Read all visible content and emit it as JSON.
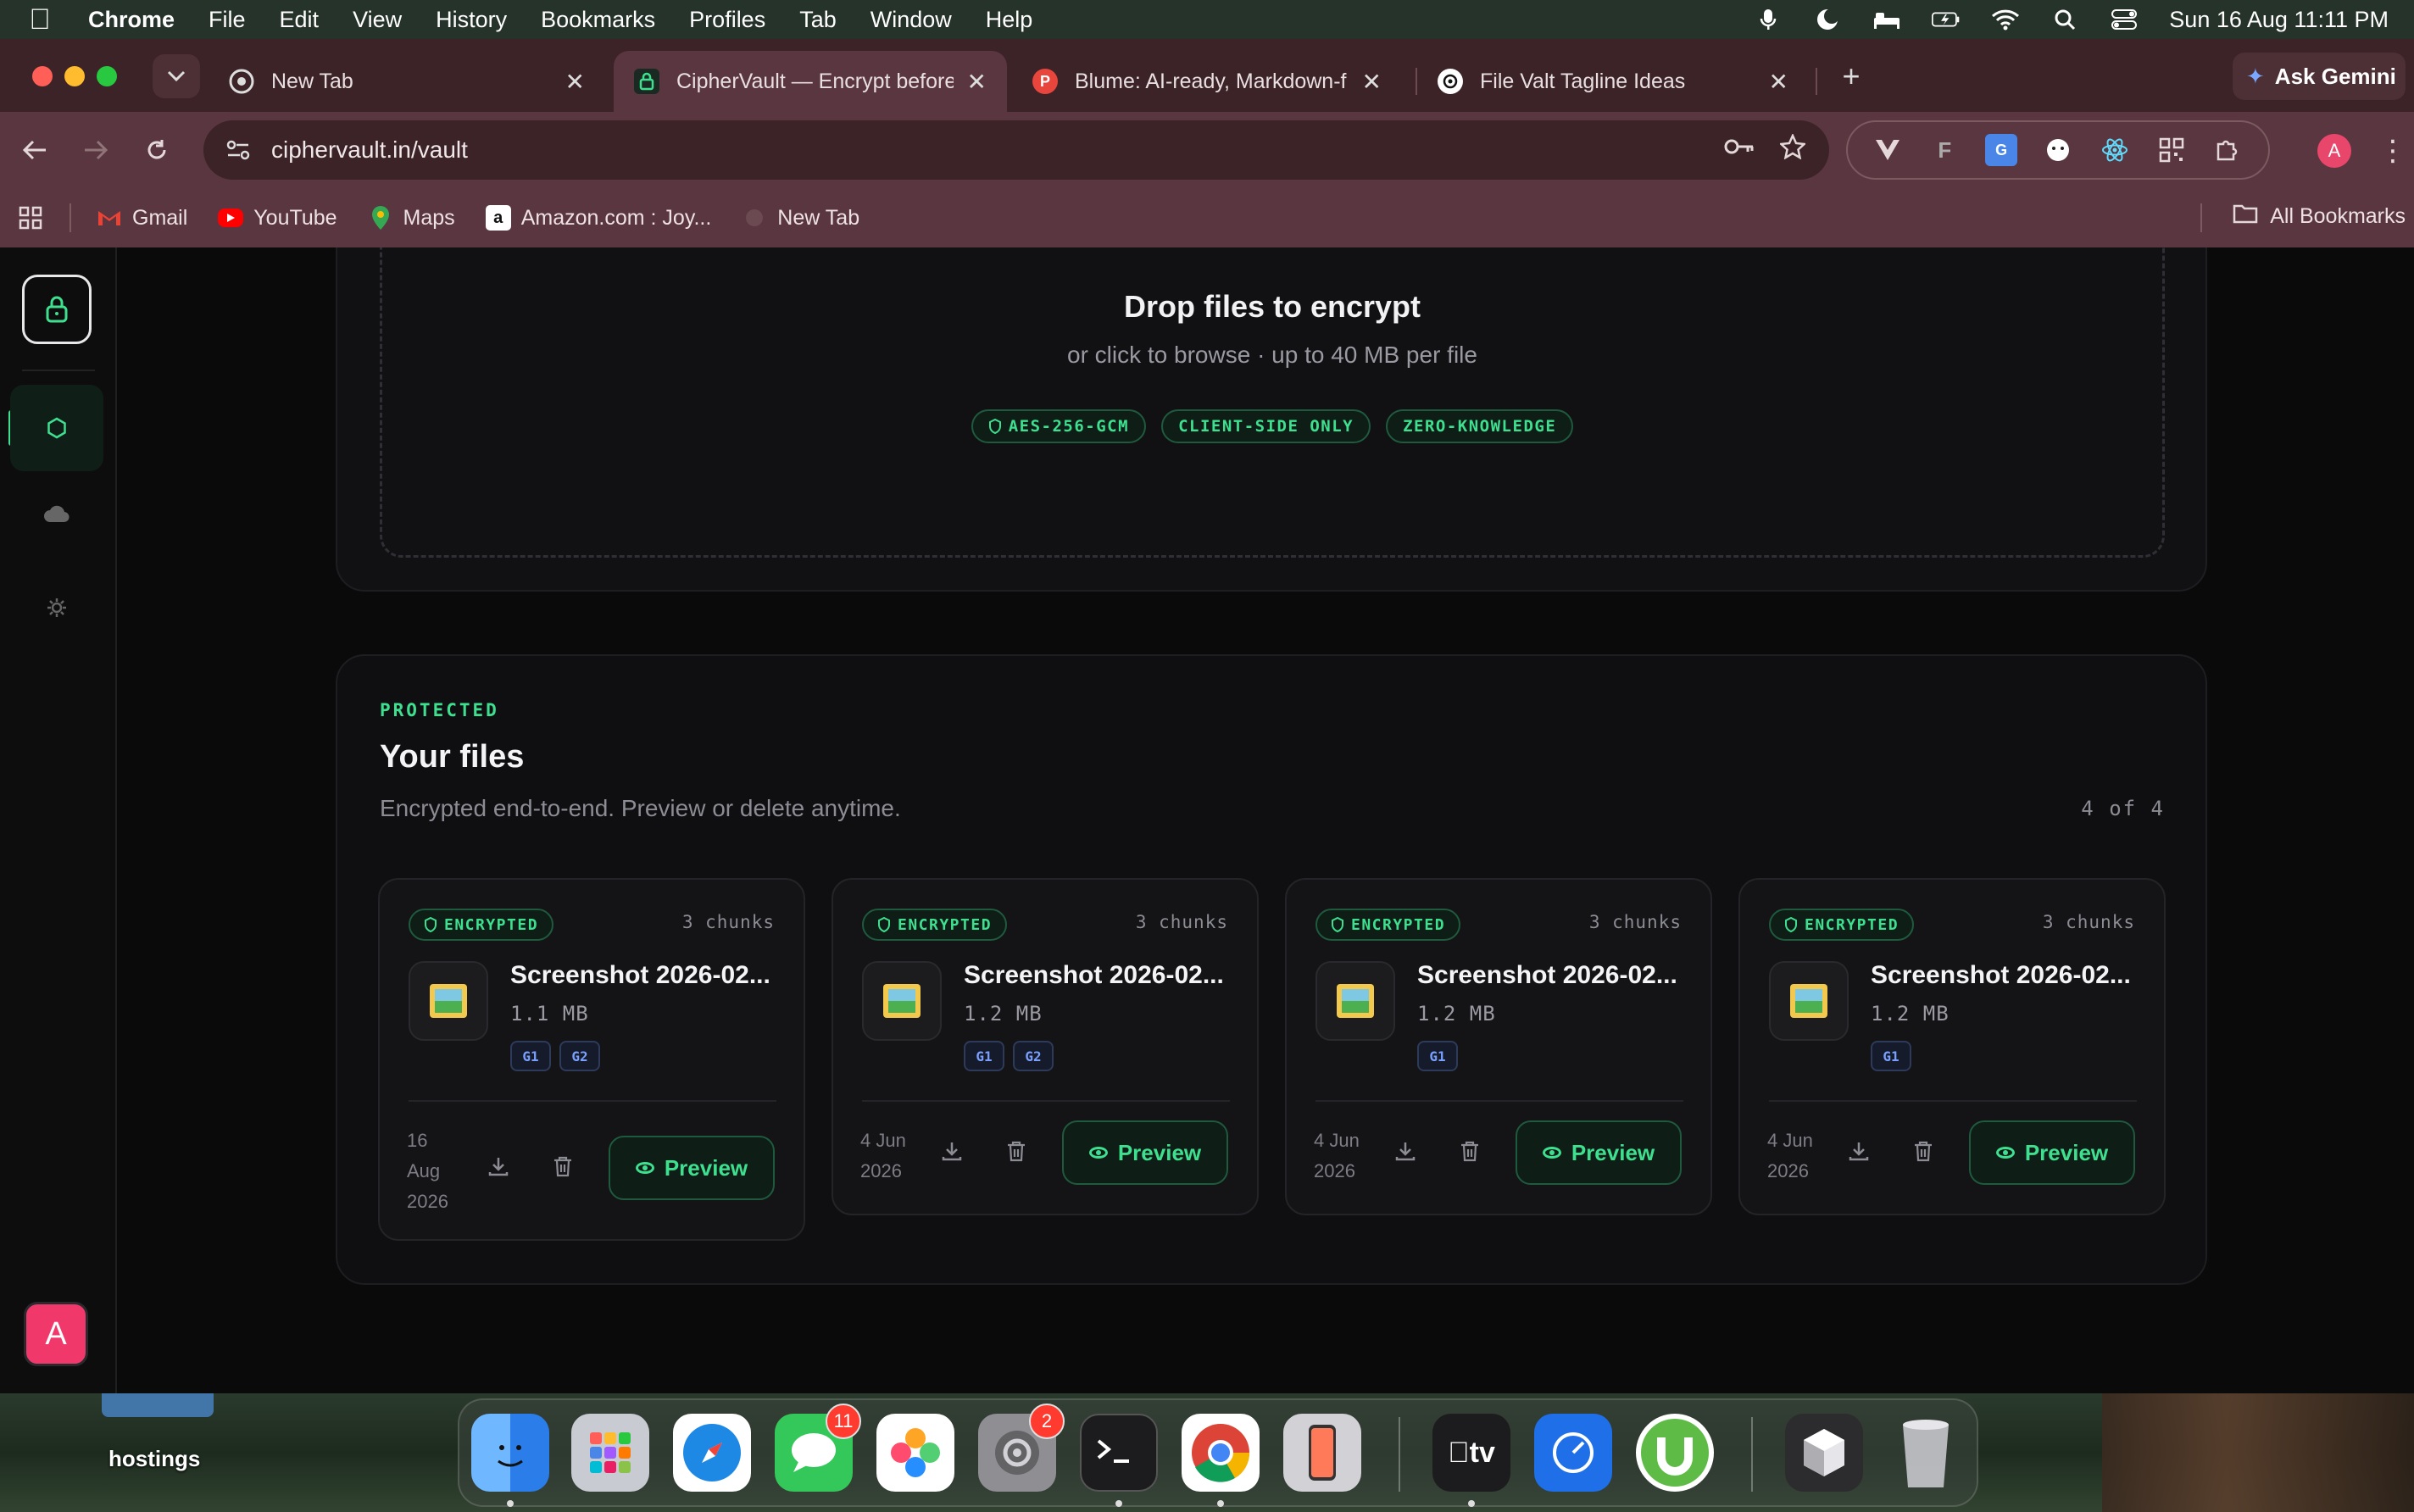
{
  "menubar": {
    "app_name": "Chrome",
    "items": [
      "File",
      "Edit",
      "View",
      "History",
      "Bookmarks",
      "Profiles",
      "Tab",
      "Window",
      "Help"
    ],
    "clock": "Sun 16 Aug  11:11 PM"
  },
  "tabs": [
    {
      "title": "New Tab",
      "icon": "chrome-icon",
      "active": false
    },
    {
      "title": "CipherVault — Encrypt before",
      "icon": "lock-icon",
      "active": true
    },
    {
      "title": "Blume: AI-ready, Markdown-f",
      "icon": "p-icon",
      "active": false
    },
    {
      "title": "File Valt Tagline Ideas",
      "icon": "openai-icon",
      "active": false
    }
  ],
  "gemini_label": "Ask Gemini",
  "address_bar": {
    "url": "ciphervault.in/vault"
  },
  "profile_initial": "A",
  "bookmarks": [
    {
      "label": "Gmail",
      "icon": "gmail-icon"
    },
    {
      "label": "YouTube",
      "icon": "youtube-icon"
    },
    {
      "label": "Maps",
      "icon": "maps-icon"
    },
    {
      "label": "Amazon.com : Joy...",
      "icon": "amazon-icon"
    },
    {
      "label": "New Tab",
      "icon": "globe-icon"
    }
  ],
  "all_bookmarks_label": "All Bookmarks",
  "app": {
    "avatar_initial": "A",
    "drop_zone": {
      "title": "Drop files to encrypt",
      "subtitle": "or click to browse · up to 40 MB per file",
      "badges": [
        "AES-256-GCM",
        "CLIENT-SIDE ONLY",
        "ZERO-KNOWLEDGE"
      ]
    },
    "files_section": {
      "eyebrow": "PROTECTED",
      "title": "Your files",
      "subtitle": "Encrypted end-to-end. Preview or delete anytime.",
      "count": "4 of 4",
      "badge_label": "ENCRYPTED",
      "preview_label": "Preview",
      "files": [
        {
          "name": "Screenshot 2026-02...",
          "size": "1.1 MB",
          "chunks": "3 chunks",
          "tags": [
            "G1",
            "G2"
          ],
          "date_lines": [
            "16",
            "Aug",
            "2026"
          ]
        },
        {
          "name": "Screenshot 2026-02...",
          "size": "1.2 MB",
          "chunks": "3 chunks",
          "tags": [
            "G1",
            "G2"
          ],
          "date_lines": [
            "4 Jun",
            "2026"
          ]
        },
        {
          "name": "Screenshot 2026-02...",
          "size": "1.2 MB",
          "chunks": "3 chunks",
          "tags": [
            "G1"
          ],
          "date_lines": [
            "4 Jun",
            "2026"
          ]
        },
        {
          "name": "Screenshot 2026-02...",
          "size": "1.2 MB",
          "chunks": "3 chunks",
          "tags": [
            "G1"
          ],
          "date_lines": [
            "4 Jun",
            "2026"
          ]
        }
      ]
    }
  },
  "desktop": {
    "label": "hostings",
    "dock_badges": {
      "messages": "11",
      "settings": "2"
    },
    "tv_label": "tv"
  },
  "colors": {
    "accent": "#3ee08f",
    "background": "#0a0a0b",
    "tab_bar": "#3b2328",
    "toolbar": "#5a3640"
  }
}
